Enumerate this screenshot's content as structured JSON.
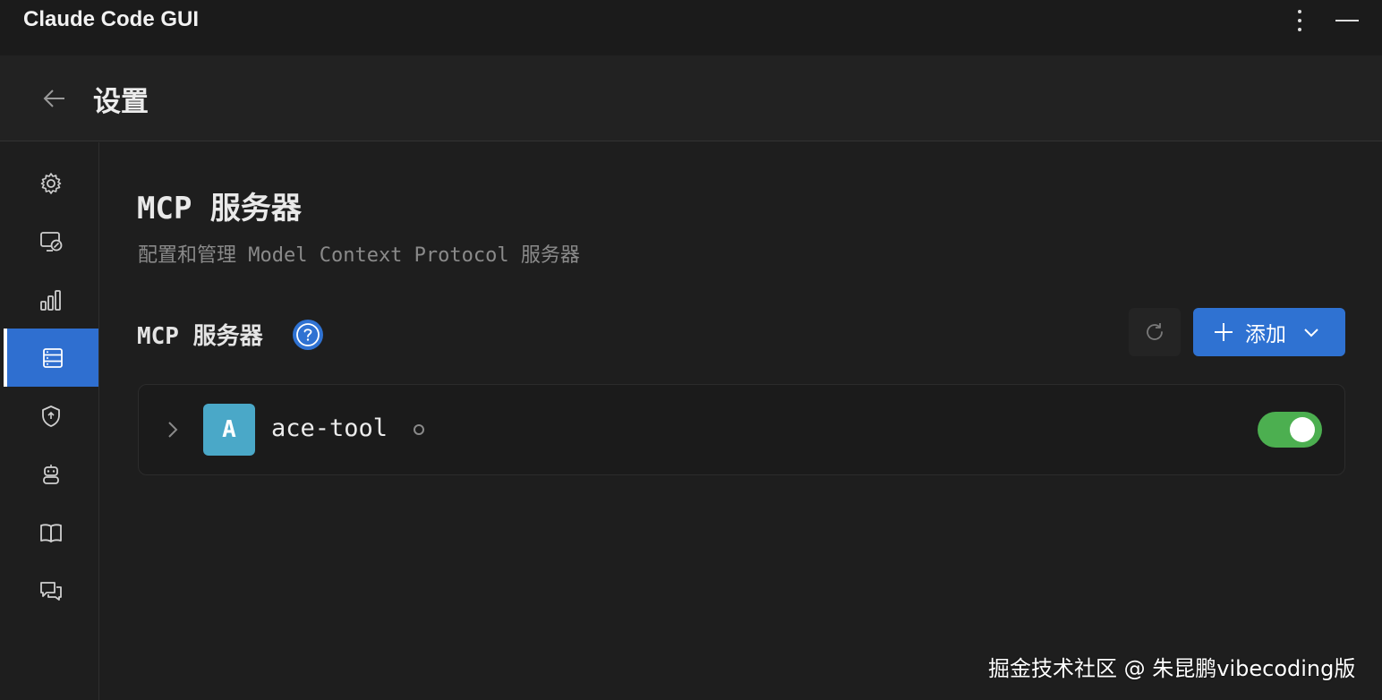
{
  "window": {
    "title": "Claude Code GUI",
    "menu_icon": "more-vertical-icon",
    "minimize_icon": "minimize-icon"
  },
  "header": {
    "title": "设置",
    "back_icon": "arrow-left-icon"
  },
  "sidebar": {
    "items": [
      {
        "icon": "gear-icon",
        "active": false
      },
      {
        "icon": "monitor-remote-icon",
        "active": false
      },
      {
        "icon": "bar-chart-icon",
        "active": false
      },
      {
        "icon": "server-icon",
        "active": true
      },
      {
        "icon": "shield-icon",
        "active": false
      },
      {
        "icon": "robot-icon",
        "active": false
      },
      {
        "icon": "book-icon",
        "active": false
      },
      {
        "icon": "chat-icon",
        "active": false
      }
    ],
    "accent": "#2f6fd0"
  },
  "main": {
    "title": "MCP 服务器",
    "description": "配置和管理 Model Context Protocol 服务器",
    "section_title": "MCP 服务器",
    "help_icon": "question-circle-icon",
    "refresh_icon": "refresh-icon",
    "add_button": {
      "label": "添加",
      "icon": "plus-icon",
      "dropdown_icon": "chevron-down-icon"
    },
    "servers": [
      {
        "avatar_letter": "A",
        "name": "ace-tool",
        "enabled": true,
        "status": "idle",
        "avatar_color": "#4aa8c8"
      }
    ]
  },
  "watermark": "掘金技术社区 @ 朱昆鹏vibecoding版",
  "colors": {
    "primary": "#2f72d2",
    "toggle_on": "#4caf50"
  }
}
